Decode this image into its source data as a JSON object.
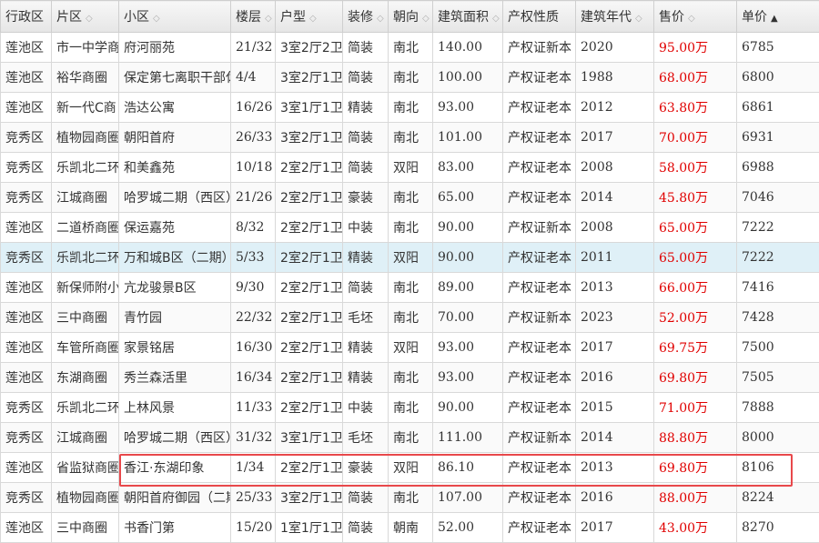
{
  "headers": [
    {
      "label": "行政区",
      "sort": ""
    },
    {
      "label": "片区",
      "sort": "◇"
    },
    {
      "label": "小区",
      "sort": "◇"
    },
    {
      "label": "楼层",
      "sort": "◇"
    },
    {
      "label": "户型",
      "sort": "◇"
    },
    {
      "label": "装修",
      "sort": "◇"
    },
    {
      "label": "朝向",
      "sort": "◇"
    },
    {
      "label": "建筑面积",
      "sort": "◇"
    },
    {
      "label": "产权性质",
      "sort": ""
    },
    {
      "label": "建筑年代",
      "sort": "◇"
    },
    {
      "label": "售价",
      "sort": "◇"
    },
    {
      "label": "单价",
      "sort": "▲"
    }
  ],
  "rows": [
    [
      "莲池区",
      "市一中学商",
      "府河丽苑",
      "21/32",
      "3室2厅2卫",
      "简装",
      "南北",
      "140.00",
      "产权证新本",
      "2020",
      "95.00万",
      "6785"
    ],
    [
      "莲池区",
      "裕华商圈",
      "保定第七离职干部休",
      "4/4",
      "3室2厅1卫",
      "简装",
      "南北",
      "100.00",
      "产权证老本",
      "1988",
      "68.00万",
      "6800"
    ],
    [
      "莲池区",
      "新一代C商",
      "浩达公寓",
      "16/26",
      "3室1厅1卫",
      "精装",
      "南北",
      "93.00",
      "产权证老本",
      "2012",
      "63.80万",
      "6861"
    ],
    [
      "竞秀区",
      "植物园商圈",
      "朝阳首府",
      "26/33",
      "3室2厅1卫",
      "简装",
      "南北",
      "101.00",
      "产权证老本",
      "2017",
      "70.00万",
      "6931"
    ],
    [
      "竞秀区",
      "乐凯北二环",
      "和美鑫苑",
      "10/18",
      "2室2厅1卫",
      "简装",
      "双阳",
      "83.00",
      "产权证老本",
      "2008",
      "58.00万",
      "6988"
    ],
    [
      "竞秀区",
      "江城商圈",
      "哈罗城二期（西区）",
      "21/26",
      "2室2厅1卫",
      "豪装",
      "南北",
      "65.00",
      "产权证老本",
      "2014",
      "45.80万",
      "7046"
    ],
    [
      "莲池区",
      "二道桥商圈",
      "保运嘉苑",
      "8/32",
      "2室2厅1卫",
      "中装",
      "南北",
      "90.00",
      "产权证新本",
      "2008",
      "65.00万",
      "7222"
    ],
    [
      "竞秀区",
      "乐凯北二环",
      "万和城B区（二期）",
      "5/33",
      "2室2厅1卫",
      "精装",
      "双阳",
      "90.00",
      "产权证老本",
      "2011",
      "65.00万",
      "7222"
    ],
    [
      "莲池区",
      "新保师附小",
      "亢龙骏景B区",
      "9/30",
      "2室2厅1卫",
      "简装",
      "南北",
      "89.00",
      "产权证老本",
      "2013",
      "66.00万",
      "7416"
    ],
    [
      "莲池区",
      "三中商圈",
      "青竹园",
      "22/32",
      "2室2厅1卫",
      "毛坯",
      "南北",
      "70.00",
      "产权证新本",
      "2023",
      "52.00万",
      "7428"
    ],
    [
      "莲池区",
      "车管所商圈",
      "家景铭居",
      "16/30",
      "2室2厅1卫",
      "精装",
      "双阳",
      "93.00",
      "产权证老本",
      "2017",
      "69.75万",
      "7500"
    ],
    [
      "莲池区",
      "东湖商圈",
      "秀兰森活里",
      "16/34",
      "2室2厅1卫",
      "精装",
      "南北",
      "93.00",
      "产权证老本",
      "2016",
      "69.80万",
      "7505"
    ],
    [
      "竞秀区",
      "乐凯北二环",
      "上林风景",
      "11/33",
      "2室2厅1卫",
      "中装",
      "南北",
      "90.00",
      "产权证老本",
      "2015",
      "71.00万",
      "7888"
    ],
    [
      "竞秀区",
      "江城商圈",
      "哈罗城二期（西区）",
      "31/32",
      "3室1厅1卫",
      "毛坯",
      "南北",
      "111.00",
      "产权证新本",
      "2014",
      "88.80万",
      "8000"
    ],
    [
      "莲池区",
      "省监狱商圈",
      "香江·东湖印象",
      "1/34",
      "2室2厅1卫",
      "豪装",
      "双阳",
      "86.10",
      "产权证老本",
      "2013",
      "69.80万",
      "8106"
    ],
    [
      "竞秀区",
      "植物园商圈",
      "朝阳首府御园（二期）",
      "25/33",
      "3室2厅1卫",
      "简装",
      "南北",
      "107.00",
      "产权证老本",
      "2016",
      "88.00万",
      "8224"
    ],
    [
      "莲池区",
      "三中商圈",
      "书香门第",
      "15/20",
      "1室1厅1卫",
      "简装",
      "朝南",
      "52.00",
      "产权证老本",
      "2017",
      "43.00万",
      "8270"
    ]
  ],
  "highlight_row": 7,
  "boxed_row": 14,
  "colors": {
    "price": "#e00000",
    "row_highlight": "#dff0f7",
    "box": "#e8484b"
  }
}
